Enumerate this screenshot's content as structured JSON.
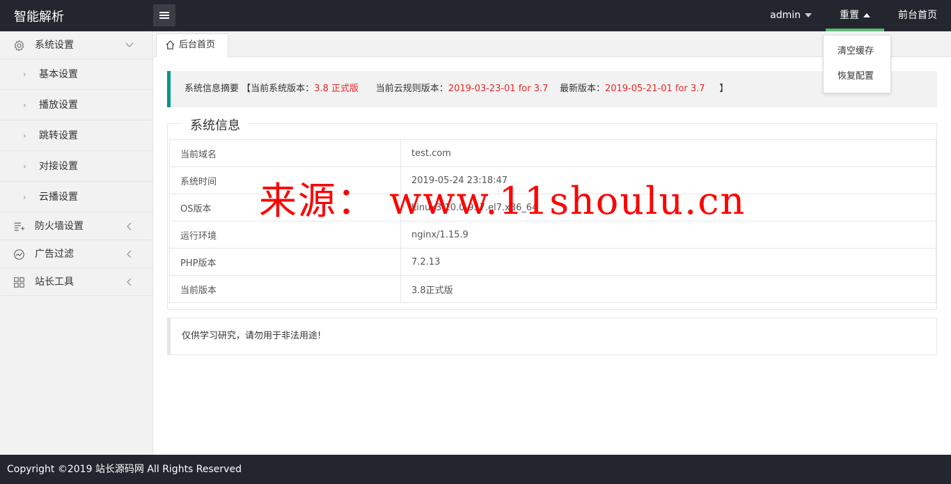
{
  "header": {
    "title": "智能解析",
    "nav": {
      "user": "admin",
      "reset": "重置",
      "frontend": "前台首页"
    },
    "reset_menu": [
      "清空缓存",
      "恢复配置"
    ]
  },
  "sidebar": {
    "system_group": "系统设置",
    "system_items": [
      "基本设置",
      "播放设置",
      "跳转设置",
      "对接设置",
      "云播设置"
    ],
    "firewall": "防火墙设置",
    "ads": "广告过滤",
    "tools": "站长工具"
  },
  "tabs": {
    "home": "后台首页"
  },
  "summary": {
    "label": "系统信息摘要",
    "open": "【当前系统版本：",
    "version": "3.8 正式版",
    "cloud_label": "当前云规则版本：",
    "cloud_version": "2019-03-23-01 for 3.7",
    "latest_label": "最新版本：",
    "latest_version": "2019-05-21-01 for 3.7",
    "close": "】"
  },
  "system_info": {
    "legend": "系统信息",
    "rows": [
      {
        "key": "当前域名",
        "value": "test.com"
      },
      {
        "key": "系统时间",
        "value": "2019-05-24 23:18:47"
      },
      {
        "key": "OS版本",
        "value": "Linux3.10.0-957.el7.x86_64"
      },
      {
        "key": "运行环境",
        "value": "nginx/1.15.9"
      },
      {
        "key": "PHP版本",
        "value": "7.2.13"
      },
      {
        "key": "当前版本",
        "value": "3.8正式版"
      }
    ]
  },
  "notice": "仅供学习研究，请勿用于非法用途!",
  "watermark": "来源： www.11shoulu.cn",
  "footer": "Copyright ©2019 站长源码网 All Rights Reserved",
  "colors": {
    "header_bg": "#23262e",
    "accent_green": "#5fb878",
    "teal": "#009688",
    "highlight_red": "#e72727"
  }
}
